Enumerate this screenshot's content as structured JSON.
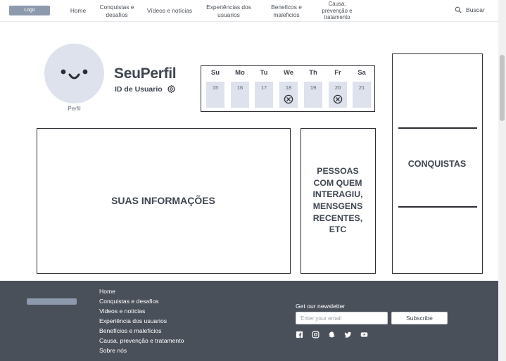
{
  "header": {
    "logo_label": "Logo",
    "nav": [
      {
        "name": "home",
        "label": "Home"
      },
      {
        "name": "conquistas",
        "label": "Conquistas e\ndesafios"
      },
      {
        "name": "videos",
        "label": "Vídeos e notícias"
      },
      {
        "name": "experiencias",
        "label": "Experiências dos\nusuarios"
      },
      {
        "name": "beneficos",
        "label": "Beneficos e\nmaleficios"
      },
      {
        "name": "causa",
        "label": "Causa,\nprevenção e\ntratamento"
      }
    ],
    "search_label": "Buscar",
    "search_icon": "search-icon"
  },
  "profile": {
    "avatar_label": "Perfil",
    "name": "SeuPerfil",
    "user_id": "ID de Usuario",
    "settings_icon": "gear-icon"
  },
  "calendar": {
    "days": [
      {
        "label": "Su",
        "date": "15",
        "marked": false
      },
      {
        "label": "Mo",
        "date": "16",
        "marked": false
      },
      {
        "label": "Tu",
        "date": "17",
        "marked": false
      },
      {
        "label": "We",
        "date": "18",
        "marked": true
      },
      {
        "label": "Th",
        "date": "19",
        "marked": false
      },
      {
        "label": "Fr",
        "date": "20",
        "marked": true
      },
      {
        "label": "Sa",
        "date": "21",
        "marked": false
      }
    ],
    "cell_color": "#dde2ec"
  },
  "panels": {
    "info": "SUAS INFORMAÇÕES",
    "people": "PESSOAS\nCOM QUEM\nINTERAGIU,\nMENSGENS\nRECENTES,\nETC",
    "achievements": "CONQUISTAS"
  },
  "footer": {
    "links": [
      "Home",
      "Conquistas e desafios",
      "Videos e notícias",
      "Experiência dos usuarios",
      "Benefícios e malefícios",
      "Causa, prevenção e tratamento",
      "Sobre nós"
    ],
    "newsletter_label": "Get our newsletter",
    "email_placeholder": "Enter your email",
    "subscribe_label": "Subscribe",
    "social_icons": [
      "facebook-icon",
      "instagram-icon",
      "snapchat-icon",
      "twitter-icon",
      "youtube-icon"
    ]
  },
  "colors": {
    "footer_bg": "#4a505a",
    "logo_bg": "#8d99ad",
    "text": "#3f4651"
  }
}
